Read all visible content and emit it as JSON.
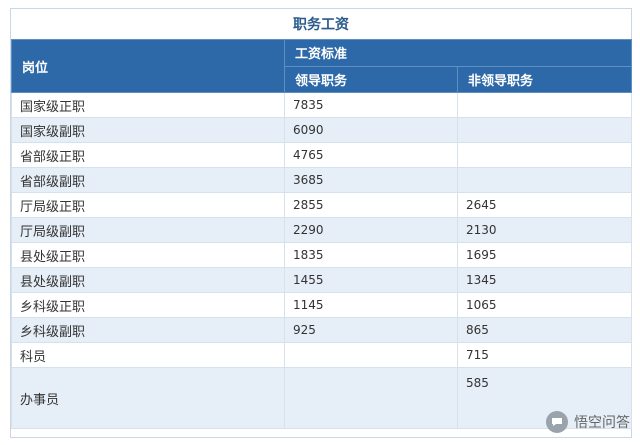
{
  "title": "职务工资",
  "header": {
    "position_col": "岗位",
    "salary_group": "工资标准",
    "leader_col": "领导职务",
    "nonleader_col": "非领导职务"
  },
  "rows": [
    {
      "position": "国家级正职",
      "leader": "7835",
      "nonleader": ""
    },
    {
      "position": "国家级副职",
      "leader": "6090",
      "nonleader": ""
    },
    {
      "position": "省部级正职",
      "leader": "4765",
      "nonleader": ""
    },
    {
      "position": "省部级副职",
      "leader": "3685",
      "nonleader": ""
    },
    {
      "position": "厅局级正职",
      "leader": "2855",
      "nonleader": "2645"
    },
    {
      "position": "厅局级副职",
      "leader": "2290",
      "nonleader": "2130"
    },
    {
      "position": "县处级正职",
      "leader": "1835",
      "nonleader": "1695"
    },
    {
      "position": "县处级副职",
      "leader": "1455",
      "nonleader": "1345"
    },
    {
      "position": "乡科级正职",
      "leader": "1145",
      "nonleader": "1065"
    },
    {
      "position": "乡科级副职",
      "leader": "925",
      "nonleader": "865"
    },
    {
      "position": "科员",
      "leader": "",
      "nonleader": "715"
    },
    {
      "position": "办事员",
      "leader": "",
      "nonleader": "585"
    }
  ],
  "watermark": {
    "text": "悟空问答",
    "icon": "speech-bubble-icon"
  },
  "colors": {
    "header_bg": "#2d69a8",
    "title_text": "#2a5b8c",
    "alt_row_bg": "#e6eef7"
  }
}
